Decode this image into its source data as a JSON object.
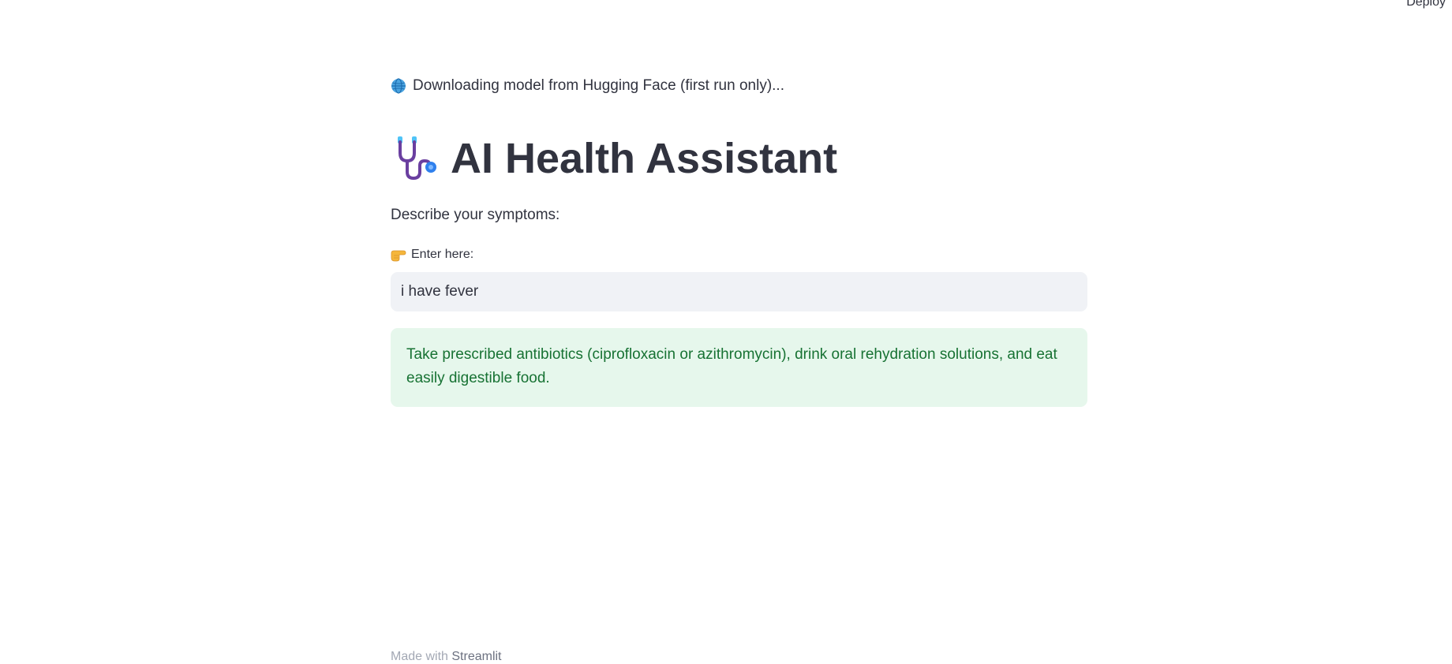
{
  "header": {
    "deploy_label": "Deploy"
  },
  "status": {
    "icon": "globe-icon",
    "text": "Downloading model from Hugging Face (first run only)..."
  },
  "title": {
    "icon": "stethoscope-icon",
    "text": "AI Health Assistant"
  },
  "subheading": "Describe your symptoms:",
  "input": {
    "icon": "pointing-hand-icon",
    "label": "Enter here:",
    "value": "i have fever"
  },
  "result": {
    "text": "Take prescribed antibiotics (ciprofloxacin or azithromycin), drink oral rehydration solutions, and eat easily digestible food."
  },
  "footer": {
    "prefix": "Made with ",
    "link": "Streamlit"
  },
  "colors": {
    "text": "#31333f",
    "input_bg": "#f0f2f6",
    "success_bg": "#e6f7ec",
    "success_text": "#177233"
  }
}
